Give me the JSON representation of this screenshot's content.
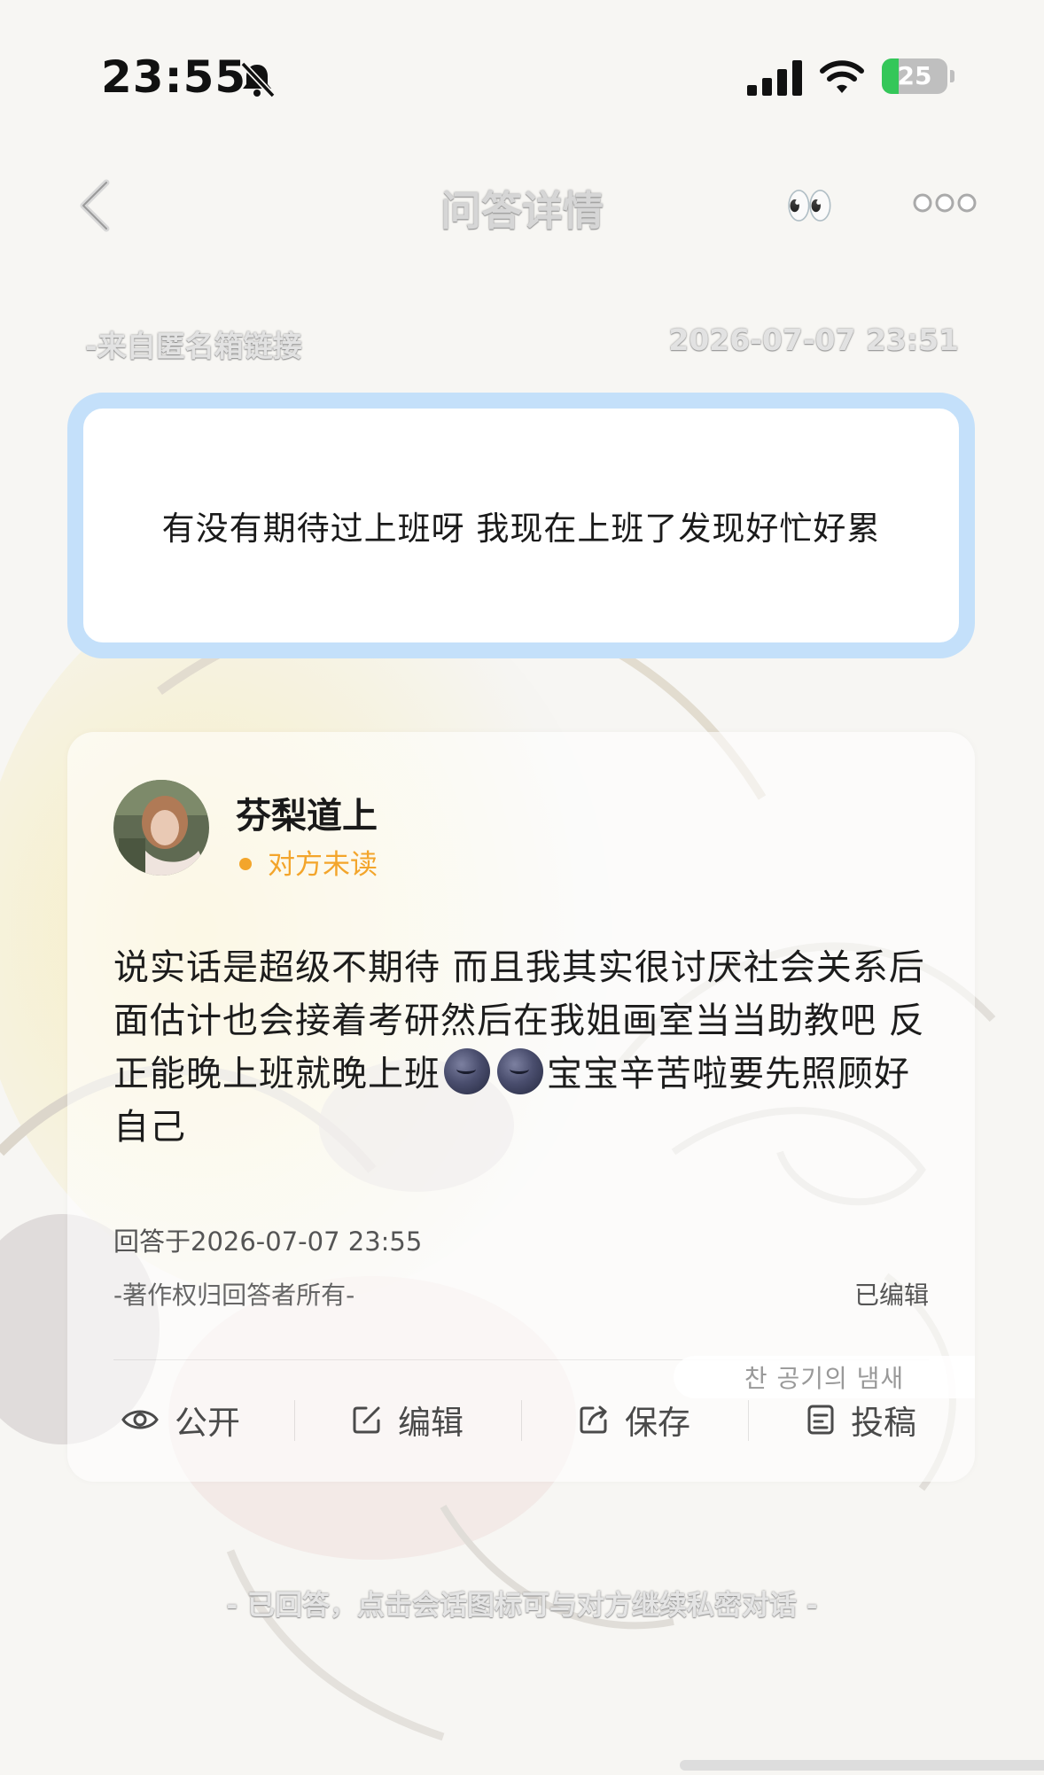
{
  "status_bar": {
    "time": "23:55",
    "battery": "25",
    "battery_level": 0.25
  },
  "nav": {
    "title": "问答详情",
    "eyes_emoji": "👀",
    "back_icon": "chevron-left-icon",
    "more_icon": "more-dots-icon"
  },
  "question": {
    "source": "-来自匿名箱链接",
    "time": "2026-07-07 23:51",
    "text": "有没有期待过上班呀 我现在上班了发现好忙好累"
  },
  "answer": {
    "author": "芬梨道上",
    "status": "对方未读",
    "text_part1": "说实话是超级不期待 而且我其实很讨厌社会关系后面估计也会接着考研然后在我姐画室当当助教吧 反正能晚上班就晚上班",
    "text_part2": "宝宝辛苦啦要先照顾好自己",
    "answered_at": "回答于2026-07-07 23:55",
    "copyright": "-著作权归回答者所有-",
    "edited": "已编辑"
  },
  "actions": [
    {
      "label": "公开",
      "icon": "eye-icon"
    },
    {
      "label": "编辑",
      "icon": "edit-icon"
    },
    {
      "label": "保存",
      "icon": "share-icon"
    },
    {
      "label": "投稿",
      "icon": "document-icon"
    }
  ],
  "watermark": "찬 공기의 냄새",
  "footer": "- 已回答，点击会话图标可与对方继续私密对话 -",
  "colors": {
    "accent": "#c4e0fa",
    "unread": "#f3a52b",
    "battery_green": "#34c759"
  }
}
